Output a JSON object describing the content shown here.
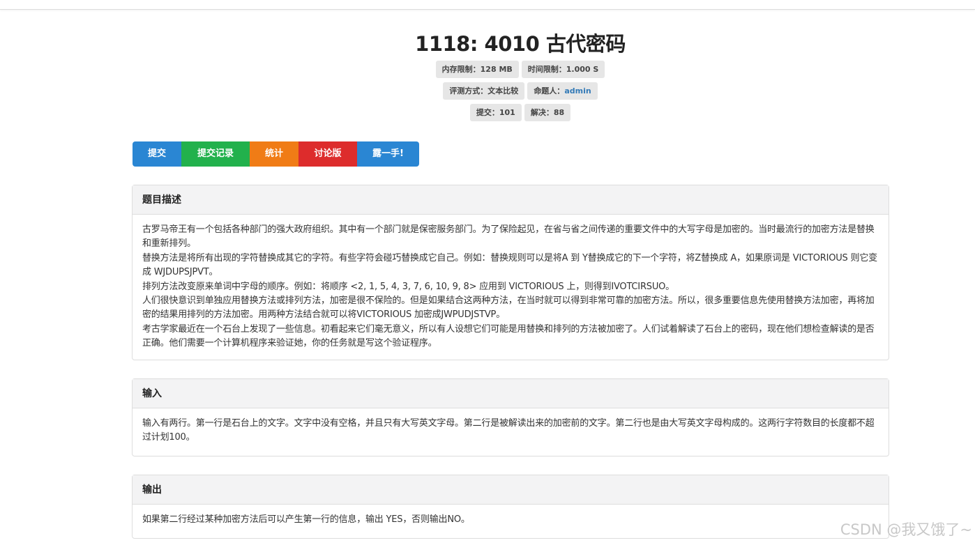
{
  "problem": {
    "title": "1118: 4010 古代密码"
  },
  "badges": {
    "memory_limit": "内存限制：128 MB",
    "time_limit": "时间限制：1.000 S",
    "judge_mode": "评测方式：文本比较",
    "author_label": "命题人：",
    "author_name": "admin",
    "submitted": "提交：101",
    "solved": "解决：88"
  },
  "actions": {
    "submit": "提交",
    "records": "提交记录",
    "stats": "统计",
    "discuss": "讨论版",
    "show_off": "露一手!"
  },
  "colors": {
    "submit": "#2a86d3",
    "records": "#22b14c",
    "stats": "#f07c16",
    "discuss": "#dd2c2c",
    "show_off": "#2a86d3"
  },
  "sections": {
    "description": {
      "heading": "题目描述",
      "paragraphs": [
        "古罗马帝王有一个包括各种部门的强大政府组织。其中有一个部门就是保密服务部门。为了保险起见，在省与省之间传递的重要文件中的大写字母是加密的。当时最流行的加密方法是替换和重新排列。",
        "替换方法是将所有出现的字符替换成其它的字符。有些字符会碰巧替换成它自己。例如：替换规则可以是将A 到 Y替换成它的下一个字符，将Z替换成 A，如果原词是 VICTORIOUS 则它变成 WJDUPSJPVT。",
        "排列方法改变原来单词中字母的顺序。例如：将顺序 <2, 1, 5, 4, 3, 7, 6, 10, 9, 8> 应用到 VICTORIOUS 上，则得到IVOTCIRSUO。",
        "人们很快意识到单独应用替换方法或排列方法，加密是很不保险的。但是如果结合这两种方法，在当时就可以得到非常可靠的加密方法。所以，很多重要信息先使用替换方法加密，再将加密的结果用排列的方法加密。用两种方法结合就可以将VICTORIOUS 加密成JWPUDJSTVP。",
        "考古学家最近在一个石台上发现了一些信息。初看起来它们毫无意义，所以有人设想它们可能是用替换和排列的方法被加密了。人们试着解读了石台上的密码，现在他们想检查解读的是否正确。他们需要一个计算机程序来验证她，你的任务就是写这个验证程序。"
      ]
    },
    "input": {
      "heading": "输入",
      "text": "输入有两行。第一行是石台上的文字。文字中没有空格，并且只有大写英文字母。第二行是被解读出来的加密前的文字。第二行也是由大写英文字母构成的。这两行字符数目的长度都不超过计划100。"
    },
    "output": {
      "heading": "输出",
      "text": "如果第二行经过某种加密方法后可以产生第一行的信息，输出 YES，否则输出NO。"
    }
  },
  "watermark": "CSDN @我又饿了~"
}
